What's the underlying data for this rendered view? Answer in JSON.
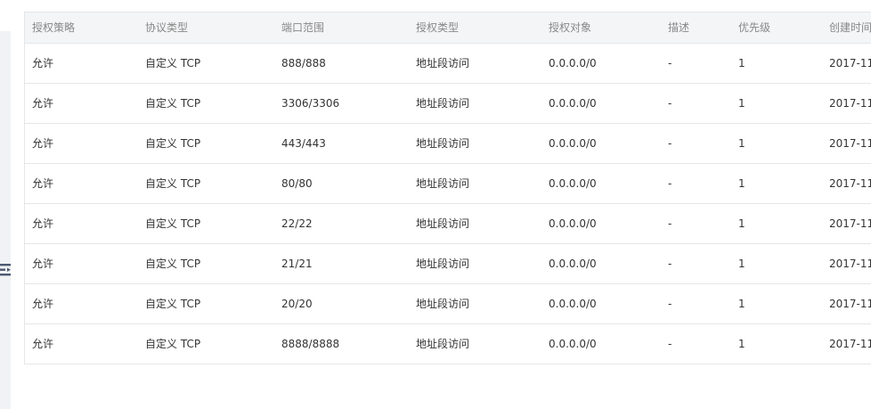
{
  "table": {
    "columns": [
      "授权策略",
      "协议类型",
      "端口范围",
      "授权类型",
      "授权对象",
      "描述",
      "优先级",
      "创建时间"
    ],
    "rows": [
      [
        "允许",
        "自定义 TCP",
        "888/888",
        "地址段访问",
        "0.0.0.0/0",
        "-",
        "1",
        "2017-11"
      ],
      [
        "允许",
        "自定义 TCP",
        "3306/3306",
        "地址段访问",
        "0.0.0.0/0",
        "-",
        "1",
        "2017-11"
      ],
      [
        "允许",
        "自定义 TCP",
        "443/443",
        "地址段访问",
        "0.0.0.0/0",
        "-",
        "1",
        "2017-11"
      ],
      [
        "允许",
        "自定义 TCP",
        "80/80",
        "地址段访问",
        "0.0.0.0/0",
        "-",
        "1",
        "2017-11"
      ],
      [
        "允许",
        "自定义 TCP",
        "22/22",
        "地址段访问",
        "0.0.0.0/0",
        "-",
        "1",
        "2017-11"
      ],
      [
        "允许",
        "自定义 TCP",
        "21/21",
        "地址段访问",
        "0.0.0.0/0",
        "-",
        "1",
        "2017-11"
      ],
      [
        "允许",
        "自定义 TCP",
        "20/20",
        "地址段访问",
        "0.0.0.0/0",
        "-",
        "1",
        "2017-11"
      ],
      [
        "允许",
        "自定义 TCP",
        "8888/8888",
        "地址段访问",
        "0.0.0.0/0",
        "-",
        "1",
        "2017-11"
      ]
    ]
  },
  "sidebar": {
    "toggle_icon": "sidebar-toggle-icon"
  },
  "colors": {
    "header_bg": "#f4f5f7",
    "border": "#e5e6e8",
    "header_text": "#888888",
    "body_text": "#333333",
    "icon": "#4a5a70"
  }
}
